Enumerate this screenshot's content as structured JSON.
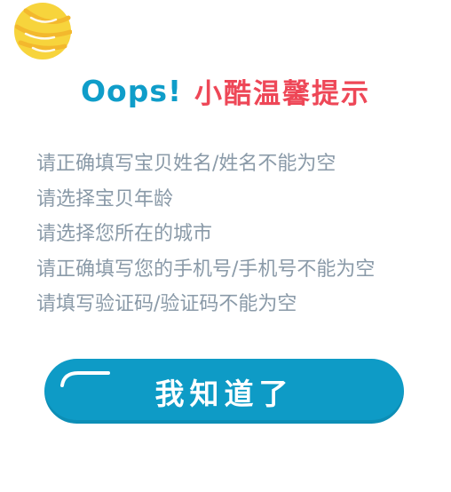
{
  "header": {
    "oops": "Oops!",
    "title": "小酷温馨提示"
  },
  "messages": [
    "请正确填写宝贝姓名/姓名不能为空",
    "请选择宝贝年龄",
    "请选择您所在的城市",
    "请正确填写您的手机号/手机号不能为空",
    "请填写验证码/验证码不能为空"
  ],
  "confirm_button": {
    "label": "我知道了"
  },
  "colors": {
    "accent": "#0e9bc6",
    "title_red": "#ee4757",
    "message_gray": "#8a9aa8",
    "moon_yellow": "#f7d43c"
  },
  "icons": {
    "moon": "moon-icon"
  }
}
